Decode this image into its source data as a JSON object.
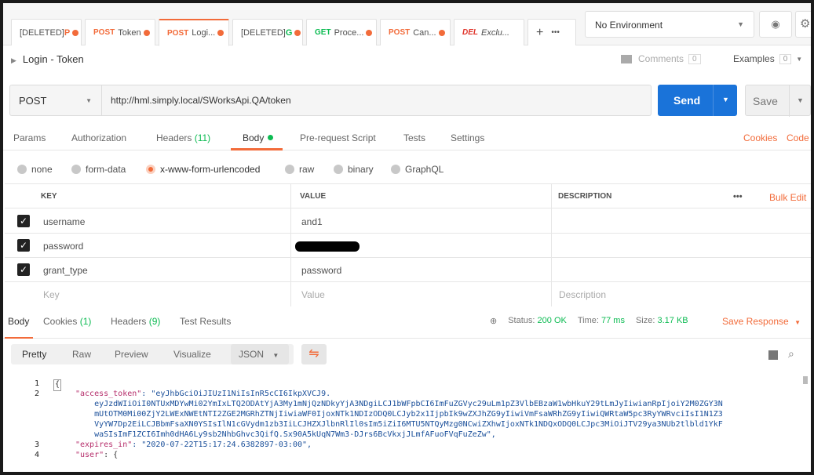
{
  "tabs": [
    {
      "method": "[DELETED]",
      "name": "P",
      "dot": true,
      "deleted": true
    },
    {
      "method": "POST",
      "name": "Token",
      "dot": true
    },
    {
      "method": "POST",
      "name": "Logi...",
      "dot": true,
      "active": true
    },
    {
      "method": "[DELETED]",
      "name": "G",
      "dot": true,
      "deleted": true
    },
    {
      "method": "GET",
      "name": "Proce...",
      "dot": true
    },
    {
      "method": "POST",
      "name": "Can...",
      "dot": true
    },
    {
      "method": "DEL",
      "name": "Exclu...",
      "dot": false
    }
  ],
  "tab_actions": {
    "new": "+",
    "more": "•••"
  },
  "environment": {
    "label": "No Environment",
    "eye_icon": "eye-icon",
    "gear_icon": "gear-icon"
  },
  "request": {
    "name": "Login - Token",
    "comments_label": "Comments",
    "comments_count": "0",
    "examples_label": "Examples",
    "examples_count": "0",
    "method": "POST",
    "url": "http://hml.simply.local/SWorksApi.QA/token",
    "send_label": "Send",
    "save_label": "Save"
  },
  "request_tabs": {
    "params": "Params",
    "authorization": "Authorization",
    "headers": "Headers",
    "headers_count": "(11)",
    "body": "Body",
    "pre_request": "Pre-request Script",
    "tests": "Tests",
    "settings": "Settings",
    "cookies": "Cookies",
    "code": "Code"
  },
  "body_types": [
    "none",
    "form-data",
    "x-www-form-urlencoded",
    "raw",
    "binary",
    "GraphQL"
  ],
  "selected_body_type": "x-www-form-urlencoded",
  "table": {
    "headers": {
      "key": "KEY",
      "value": "VALUE",
      "description": "DESCRIPTION",
      "more": "•••",
      "bulk_edit": "Bulk Edit"
    },
    "rows": [
      {
        "key": "username",
        "value": "and1",
        "checked": true
      },
      {
        "key": "password",
        "value": "",
        "checked": true,
        "redacted": true
      },
      {
        "key": "grant_type",
        "value": "password",
        "checked": true
      }
    ],
    "placeholder": {
      "key": "Key",
      "value": "Value",
      "description": "Description"
    }
  },
  "response": {
    "tabs": {
      "body": "Body",
      "cookies": "Cookies",
      "cookies_count": "(1)",
      "headers": "Headers",
      "headers_count": "(9)",
      "test_results": "Test Results"
    },
    "status_label": "Status:",
    "status_value": "200 OK",
    "time_label": "Time:",
    "time_value": "77 ms",
    "size_label": "Size:",
    "size_value": "3.17 KB",
    "save_response": "Save Response",
    "views": {
      "pretty": "Pretty",
      "raw": "Raw",
      "preview": "Preview",
      "visualize": "Visualize",
      "format": "JSON"
    }
  },
  "code_lines": [
    {
      "n": "1",
      "text": "{"
    },
    {
      "n": "2",
      "key": "\"access_token\"",
      "val": ": \"eyJhbGciOiJIUzI1NiIsInR5cCI6IkpXVCJ9."
    },
    {
      "n": "",
      "text": "    eyJzdWIiOiI0NTUxMDYwMi02YmIxLTQ2ODAtYjA3My1mNjQzNDkyYjA3NDgiLCJ1bWFpbCI6ImFuZGVyc29uLm1pZ3VlbEBzaW1wbHkuY29tLmJyIiwianRpIjoiY2M0ZGY3N"
    },
    {
      "n": "",
      "text": "    mUtOTM0Mi00ZjY2LWExNWEtNTI2ZGE2MGRhZTNjIiwiaWF0IjoxNTk1NDIzODQ0LCJyb2x1IjpbIk9wZXJhZG9yIiwiVmFsaWRhZG9yIiwiQWRtaW5pc3RyYWRvciIsI1N1Z3"
    },
    {
      "n": "",
      "text": "    VyYW7Dp2EiLCJBbmFsaXN0YSIsIlN1cGVydm1zb3IiLCJHZXJlbnRlIl0sIm5iZiI6MTU5NTQyMzg0NCwiZXhwIjoxNTk1NDQxODQ0LCJpc3MiOiJTV29ya3NUb2tlbld1YkF"
    },
    {
      "n": "",
      "text": "    waSIsImF1ZCI6Imh0dHA6Ly9sb2NhbGhvc3QifQ.Sx90A5kUqN7Wm3-DJrs6BcVkxjJLmfAFuoFVqFuZeZw\","
    },
    {
      "n": "3",
      "key": "\"expires_in\"",
      "val": ": \"2020-07-22T15:17:24.6382897-03:00\","
    },
    {
      "n": "4",
      "key": "\"user\"",
      "val": ": {"
    }
  ]
}
